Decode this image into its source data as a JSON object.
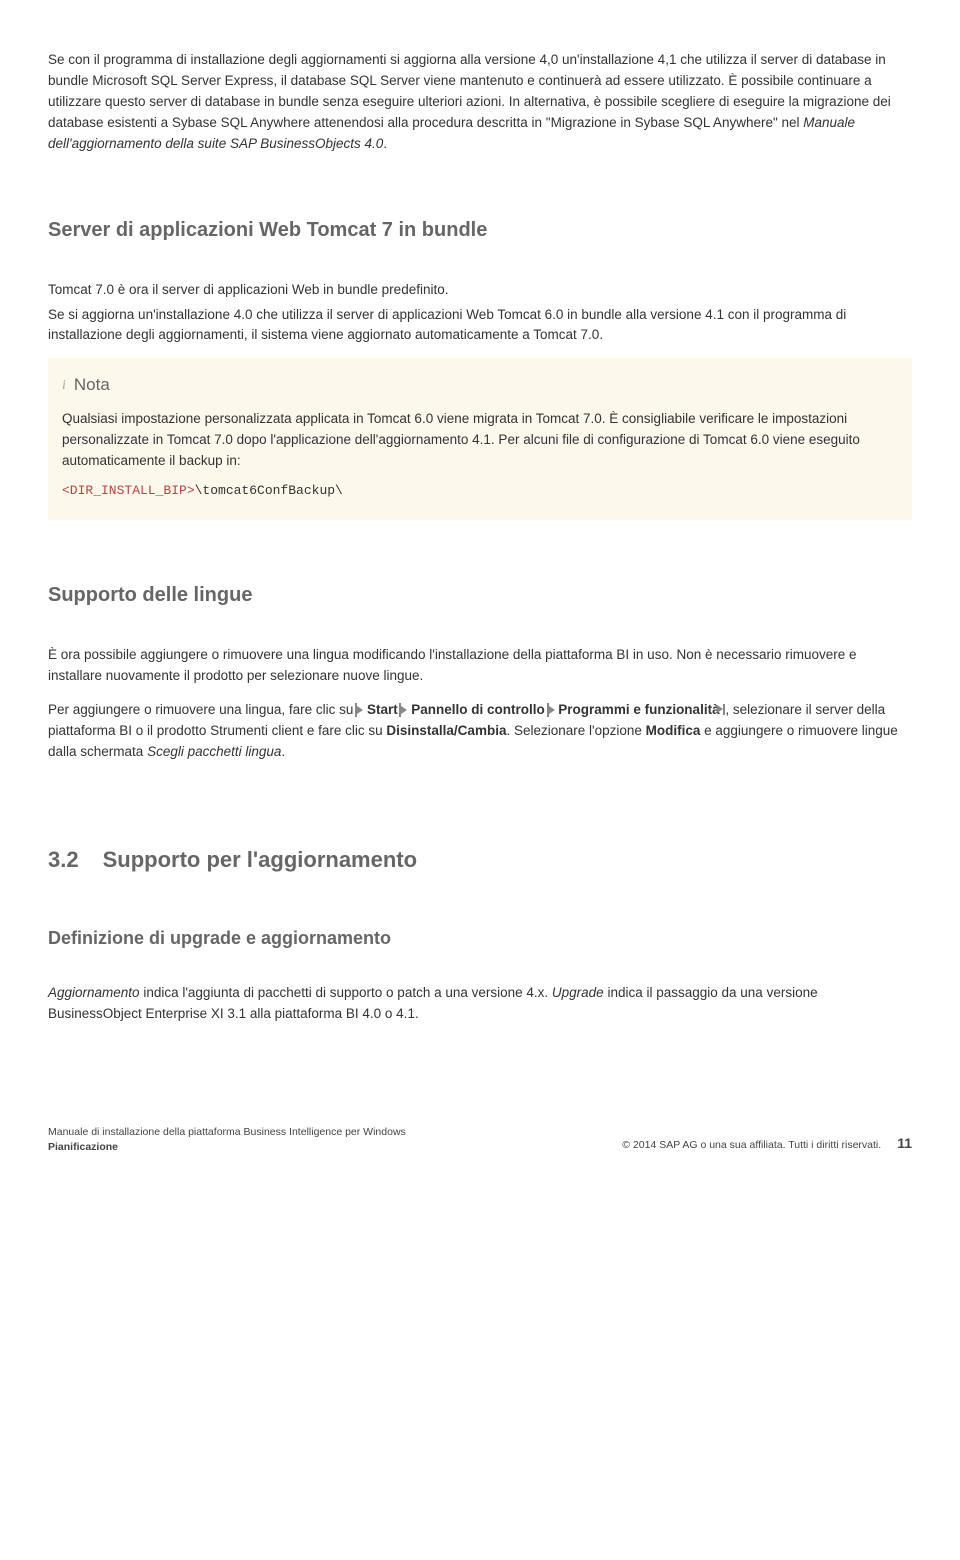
{
  "para1": "Se con il programma di installazione degli aggiornamenti si aggiorna alla versione 4,0 un'installazione 4,1 che utilizza il server di database in bundle Microsoft SQL Server Express, il database SQL Server viene mantenuto e continuerà ad essere utilizzato. È possibile continuare a utilizzare questo server di database in bundle senza eseguire ulteriori azioni. In alternativa, è possibile scegliere di eseguire la migrazione dei database esistenti a Sybase SQL Anywhere attenendosi alla procedura descritta in \"Migrazione in Sybase SQL Anywhere\" nel ",
  "para1_italic": "Manuale dell'aggiornamento della suite SAP BusinessObjects 4.0",
  "para1_end": ".",
  "h_tomcat": "Server di applicazioni Web Tomcat 7 in bundle",
  "tomcat_p1": "Tomcat 7.0 è ora il server di applicazioni Web in bundle predefinito.",
  "tomcat_p2": "Se si aggiorna un'installazione 4.0 che utilizza il server di applicazioni Web Tomcat 6.0 in bundle alla versione 4.1 con il programma di installazione degli aggiornamenti, il sistema viene aggiornato automaticamente a Tomcat 7.0.",
  "note_label": "Nota",
  "note_body": "Qualsiasi impostazione personalizzata applicata in Tomcat 6.0 viene migrata in Tomcat 7.0. È consigliabile verificare le impostazioni personalizzate in Tomcat 7.0 dopo l'applicazione dell'aggiornamento 4.1. Per alcuni file di configurazione di Tomcat 6.0 viene eseguito automaticamente il backup in:",
  "code_red": "<DIR_INSTALL_BIP>",
  "code_rest": "\\tomcat6ConfBackup\\",
  "h_lang": "Supporto delle lingue",
  "lang_p1": "È ora possibile aggiungere o rimuovere una lingua modificando l'installazione della piattaforma BI in uso. Non è necessario rimuovere e installare nuovamente il prodotto per selezionare nuove lingue.",
  "lang_p2_a": "Per aggiungere o rimuovere una lingua, fare clic su ",
  "lang_nav1": "Start",
  "lang_nav2": "Pannello di controllo",
  "lang_nav3": "Programmi e funzionalità",
  "lang_p2_b": ", selezionare il server della piattaforma BI o il prodotto Strumenti client e fare clic su ",
  "lang_b1": "Disinstalla/Cambia",
  "lang_p2_c": ". Selezionare l'opzione ",
  "lang_b2": "Modifica",
  "lang_p2_d": " e aggiungere o rimuovere lingue dalla schermata ",
  "lang_i1": "Scegli pacchetti lingua",
  "h_num": "3.2",
  "h_num_title": "Supporto per l'aggiornamento",
  "h_def": "Definizione di upgrade e aggiornamento",
  "def_i1": "Aggiornamento",
  "def_p1": " indica l'aggiunta di pacchetti di supporto o patch a una versione 4.x. ",
  "def_i2": "Upgrade",
  "def_p2": " indica il passaggio da una versione BusinessObject Enterprise XI 3.1 alla piattaforma BI 4.0 o 4.1.",
  "footer_l1": "Manuale di installazione della piattaforma Business Intelligence per Windows",
  "footer_l2": "Pianificazione",
  "footer_r": "© 2014 SAP AG o una sua affiliata. Tutti i diritti riservati.",
  "page": "11"
}
